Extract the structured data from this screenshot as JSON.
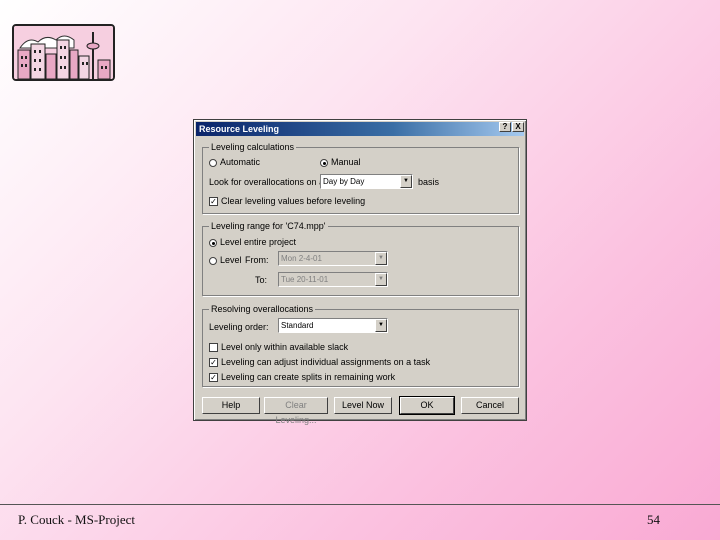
{
  "dialog": {
    "title": "Resource Leveling",
    "help_glyph": "?",
    "close_glyph": "X",
    "calc_group": {
      "legend": "Leveling calculations",
      "automatic_label": "Automatic",
      "manual_label": "Manual",
      "manual_selected": true,
      "look_for_label": "Look for overallocations on a",
      "look_for_value": "Day by Day",
      "basis_label": "basis",
      "clear_label": "Clear leveling values before leveling",
      "clear_checked": true
    },
    "range_group": {
      "legend": "Leveling range for 'C74.mpp'",
      "entire_label": "Level entire project",
      "entire_selected": true,
      "level_label": "Level",
      "from_label": "From:",
      "from_value": "Mon 2-4-01",
      "to_label": "To:",
      "to_value": "Tue 20-11-01"
    },
    "resolve_group": {
      "legend": "Resolving overallocations",
      "order_label": "Leveling order:",
      "order_value": "Standard",
      "slack_label": "Level only within available slack",
      "slack_checked": false,
      "adjust_label": "Leveling can adjust individual assignments on a task",
      "adjust_checked": true,
      "splits_label": "Leveling can create splits in remaining work",
      "splits_checked": true
    },
    "buttons": {
      "help": "Help",
      "clear_leveling": "Clear Leveling...",
      "level_now": "Level Now",
      "ok": "OK",
      "cancel": "Cancel"
    }
  },
  "footer": {
    "left": "P. Couck - MS-Project",
    "page_number": "54"
  }
}
